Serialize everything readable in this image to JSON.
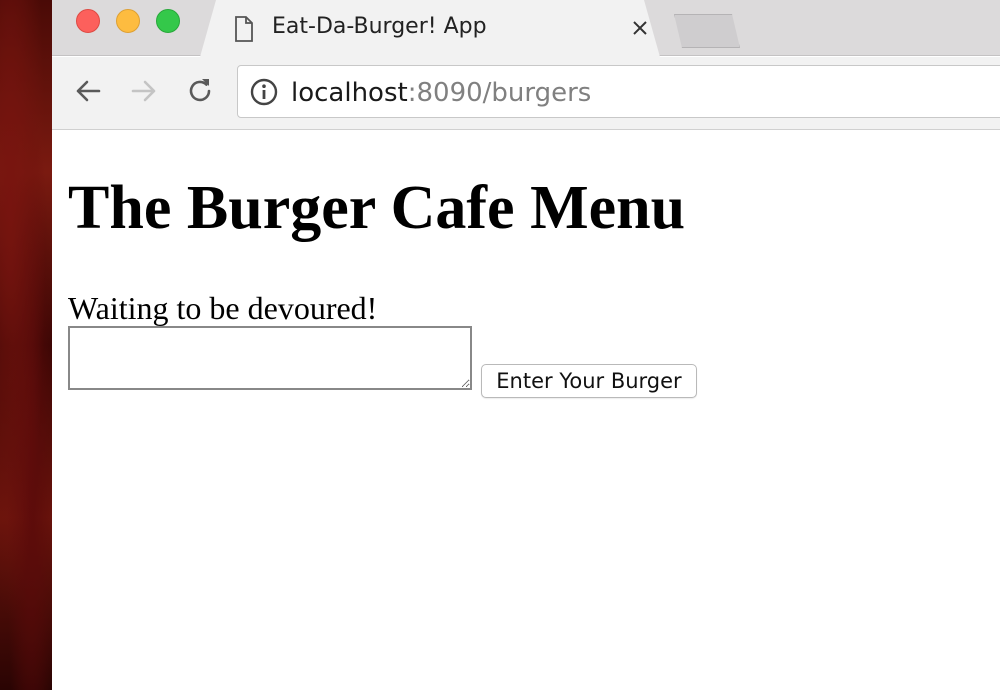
{
  "browser": {
    "tab": {
      "title": "Eat-Da-Burger! App",
      "icon": "document-icon"
    },
    "address_bar": {
      "host": "localhost",
      "rest": ":8090/burgers",
      "icon": "info-icon"
    },
    "nav": {
      "back_icon": "back-arrow-icon",
      "forward_icon": "forward-arrow-icon",
      "reload_icon": "reload-icon"
    },
    "traffic_lights": {
      "close": "#fc605c",
      "minimize": "#fdbc40",
      "maximize": "#34c84a"
    }
  },
  "page": {
    "title": "The Burger Cafe Menu",
    "waiting_label": "Waiting to be devoured!",
    "burger_input": {
      "value": "",
      "placeholder": ""
    },
    "submit_label": "Enter Your Burger"
  }
}
